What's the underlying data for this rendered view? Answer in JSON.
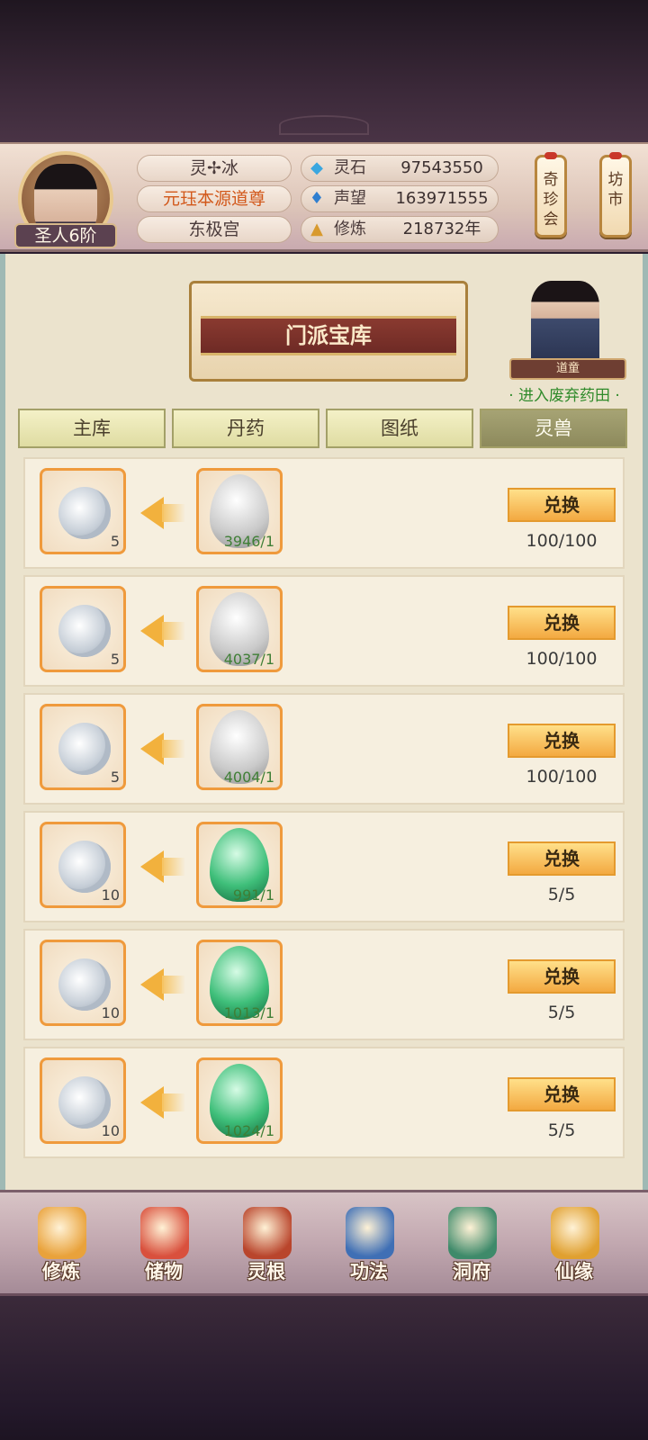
{
  "player": {
    "rank": "圣人6阶",
    "name": "灵✢冰",
    "title": "元珏本源道尊",
    "sect": "东极宫"
  },
  "stats": [
    {
      "icon": "spirit-stone-icon",
      "label": "灵石",
      "value": "97543550"
    },
    {
      "icon": "prestige-icon",
      "label": "声望",
      "value": "163971555"
    },
    {
      "icon": "meditation-icon",
      "label": "修炼",
      "value": "218732年"
    }
  ],
  "side_buttons": {
    "treasure_fair": "奇珍会",
    "market": "坊市"
  },
  "banner": {
    "title": "门派宝库"
  },
  "npc": {
    "tag": "道童",
    "link": "· 进入废弃药田 ·"
  },
  "tabs": [
    {
      "label": "主库",
      "active": false
    },
    {
      "label": "丹药",
      "active": false
    },
    {
      "label": "图纸",
      "active": false
    },
    {
      "label": "灵兽",
      "active": true
    }
  ],
  "items": [
    {
      "cost_qty": "5",
      "reward_qty": "3946/1",
      "egg": "silver",
      "button": "兑换",
      "limit": "100/100"
    },
    {
      "cost_qty": "5",
      "reward_qty": "4037/1",
      "egg": "silver",
      "button": "兑换",
      "limit": "100/100"
    },
    {
      "cost_qty": "5",
      "reward_qty": "4004/1",
      "egg": "silver",
      "button": "兑换",
      "limit": "100/100"
    },
    {
      "cost_qty": "10",
      "reward_qty": "991/1",
      "egg": "jade",
      "button": "兑换",
      "limit": "5/5"
    },
    {
      "cost_qty": "10",
      "reward_qty": "1013/1",
      "egg": "jade",
      "button": "兑换",
      "limit": "5/5"
    },
    {
      "cost_qty": "10",
      "reward_qty": "1024/1",
      "egg": "jade",
      "button": "兑换",
      "limit": "5/5"
    }
  ],
  "nav": [
    {
      "label": "修炼",
      "icon": "cultivate-icon",
      "color": "#e9a23b"
    },
    {
      "label": "储物",
      "icon": "storage-bag-icon",
      "color": "#d9503d"
    },
    {
      "label": "灵根",
      "icon": "spirit-root-icon",
      "color": "#b9452c"
    },
    {
      "label": "功法",
      "icon": "scripture-book-icon",
      "color": "#3f6fb5"
    },
    {
      "label": "洞府",
      "icon": "cave-mansion-icon",
      "color": "#3e8a6a"
    },
    {
      "label": "仙缘",
      "icon": "gourd-icon",
      "color": "#e0a030"
    }
  ]
}
